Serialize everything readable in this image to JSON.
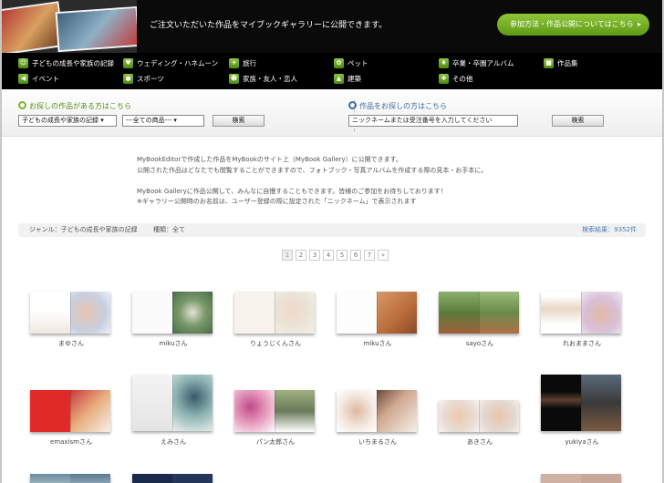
{
  "banner": {
    "message": "ご注文いただいた作品をマイブックギャラリーに公開できます。",
    "button_label": "参加方法・作品公開についてはこちら",
    "button_arrow": "▸"
  },
  "genres": [
    {
      "label": "子どもの成長や家族の記録",
      "icon": "child-icon"
    },
    {
      "label": "ウェディング・ハネムーン",
      "icon": "wedding-icon"
    },
    {
      "label": "旅行",
      "icon": "travel-icon"
    },
    {
      "label": "ペット",
      "icon": "pet-icon"
    },
    {
      "label": "卒業・卒園アルバム",
      "icon": "graduation-icon"
    },
    {
      "label": "作品集",
      "icon": "portfolio-icon"
    },
    {
      "label": "イベント",
      "icon": "event-icon"
    },
    {
      "label": "スポーツ",
      "icon": "sports-icon"
    },
    {
      "label": "家族・友人・恋人",
      "icon": "family-icon"
    },
    {
      "label": "建築",
      "icon": "architecture-icon"
    },
    {
      "label": "その他",
      "icon": "other-icon"
    }
  ],
  "search": {
    "genre_title": "お探しの作品がある方はこちら",
    "genre_select_value": "子どもの成長や家族の記録",
    "product_select_value": "---全ての商品---",
    "genre_search_button": "検索",
    "name_title": "作品をお探しの方はこちら",
    "name_input_placeholder": "ニックネームまたは受注番号を入力してください",
    "name_search_button": "検索"
  },
  "intro": {
    "line1": "MyBookEditorで作成した作品をMyBookのサイト上（MyBook Gallery）に公開できます。",
    "line2": "公開された作品はどなたでも閲覧することができますので、フォトブック・写真アルバムを作成する際の見本・お手本に。",
    "line3": "MyBook Galleryに作品公開して、みんなに自慢することもできます。皆様のご参加をお待ちしております！",
    "line4": "※ギャラリー公開時のお名前は、ユーザー登録の際に設定された「ニックネーム」で表示されます"
  },
  "results": {
    "genre_label": "ジャンル：子どもの成長や家族の記録",
    "type_label": "種類：全て",
    "count_label": "検索結果：9352件"
  },
  "pagination": [
    "1",
    "2",
    "3",
    "4",
    "5",
    "6",
    "7",
    "»"
  ],
  "gallery": [
    {
      "name": "まゆさん"
    },
    {
      "name": "mikuさん"
    },
    {
      "name": "りょうじくんさん"
    },
    {
      "name": "mikuさん"
    },
    {
      "name": "sayoさん"
    },
    {
      "name": "れおままさん"
    },
    {
      "name": "emaxismさん"
    },
    {
      "name": "えみさん"
    },
    {
      "name": "パン太郎さん"
    },
    {
      "name": "いちまるさん"
    },
    {
      "name": "あきさん"
    },
    {
      "name": "yukiyaさん"
    }
  ],
  "colors": {
    "accent_green": "#6fae22",
    "header_bg": "#0a0a0a",
    "link_blue": "#4a7fb5"
  }
}
